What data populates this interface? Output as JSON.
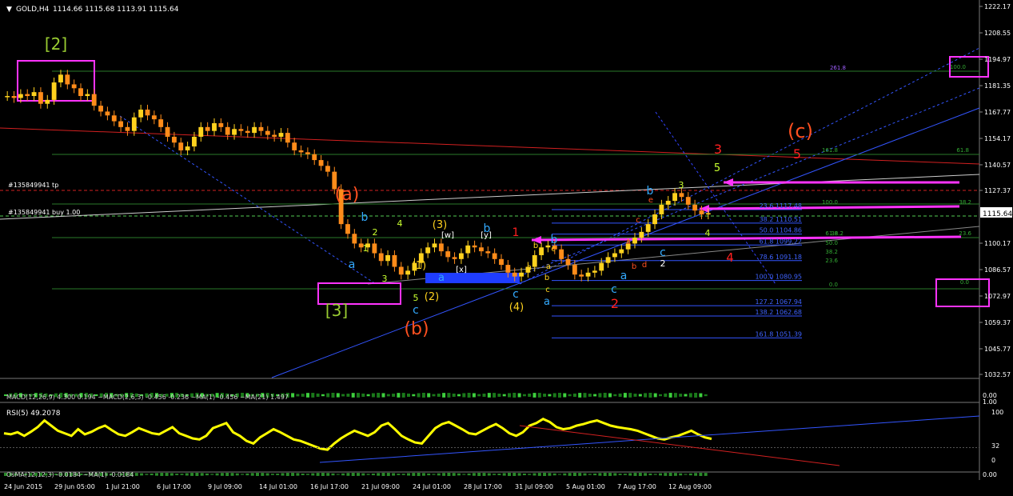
{
  "window": {
    "symbol_title": "GOLD,H4",
    "ohlc": "1114.66 1115.68 1113.91 1115.64",
    "order_tp_label": "#135849941 tp",
    "order_buy_label": "#135849941 buy 1.00",
    "current_price": "1115.64"
  },
  "chart_data": {
    "type": "line",
    "symbol": "GOLD",
    "timeframe": "H4",
    "ylim": [
      1032.57,
      1222.17
    ],
    "y_ticks": [
      "1222.17",
      "1208.55",
      "1194.97",
      "1181.35",
      "1167.77",
      "1154.17",
      "1140.57",
      "1127.37",
      "1115.64",
      "1100.17",
      "1086.57",
      "1072.97",
      "1059.37",
      "1045.77",
      "1032.57"
    ],
    "x_ticks": [
      "24 Jun 2015",
      "29 Jun 05:00",
      "1 Jul 21:00",
      "6 Jul 17:00",
      "9 Jul 09:00",
      "14 Jul 01:00",
      "16 Jul 17:00",
      "21 Jul 09:00",
      "24 Jul 01:00",
      "28 Jul 17:00",
      "31 Jul 09:00",
      "5 Aug 01:00",
      "7 Aug 17:00",
      "12 Aug 09:00"
    ],
    "series": [
      {
        "values": [
          1176,
          1175,
          1177,
          1176,
          1178,
          1172,
          1174,
          1183,
          1187,
          1182,
          1180,
          1176,
          1177,
          1171,
          1168,
          1166,
          1163,
          1160,
          1158,
          1165,
          1169,
          1166,
          1164,
          1160,
          1155,
          1152,
          1148,
          1150,
          1155,
          1160,
          1158,
          1162,
          1160,
          1156,
          1159,
          1158,
          1157,
          1160,
          1158,
          1156,
          1155,
          1157,
          1152,
          1148,
          1147,
          1146,
          1143,
          1140,
          1137,
          1128,
          1110,
          1105,
          1100,
          1098,
          1100,
          1095,
          1091,
          1094,
          1088,
          1084,
          1086,
          1090,
          1095,
          1098,
          1100,
          1096,
          1093,
          1092,
          1095,
          1099,
          1098,
          1096,
          1095,
          1092,
          1089,
          1085,
          1083,
          1085,
          1088,
          1094,
          1098,
          1099,
          1097,
          1092,
          1089,
          1084,
          1083,
          1085,
          1086,
          1090,
          1093,
          1095,
          1097,
          1100,
          1103,
          1106,
          1110,
          1115,
          1120,
          1122,
          1126,
          1124,
          1120,
          1117,
          1115,
          1115.64
        ]
      }
    ],
    "fib_levels": [
      {
        "ratio": "23.6",
        "price": "1117.48"
      },
      {
        "ratio": "38.2",
        "price": "1110.51"
      },
      {
        "ratio": "50.0",
        "price": "1104.86"
      },
      {
        "ratio": "61.8",
        "price": "1099.22"
      },
      {
        "ratio": "78.6",
        "price": "1091.18"
      },
      {
        "ratio": "100.0",
        "price": "1080.95"
      },
      {
        "ratio": "127.2",
        "price": "1067.94"
      },
      {
        "ratio": "138.2",
        "price": "1062.68"
      },
      {
        "ratio": "161.8",
        "price": "1051.39"
      }
    ],
    "fib_right": [
      "261.8",
      "161.8",
      "61.8",
      "38.2",
      "100.0",
      "38.2",
      "23.6",
      "61.8",
      "50.0",
      "38.2",
      "23.6",
      "0.0",
      "100.0",
      "0.0"
    ],
    "wave_labels": {
      "top": "[2]",
      "bottom": "[3]",
      "a_big": "(a)",
      "b_big": "(b)",
      "c_big": "(c)",
      "red3": "3",
      "red5": "5",
      "red1": "1",
      "red2": "2",
      "red4": "4",
      "w1": "1",
      "w2": "2",
      "w3": "3",
      "w4": "4",
      "w5": "5",
      "p1": "(1)",
      "p2": "(2)",
      "p3": "(3)",
      "p4": "(4)",
      "bw": "[w]",
      "bx": "[x]",
      "by": "[y]",
      "a": "a",
      "b": "b",
      "c": "c",
      "d": "d",
      "e": "e"
    },
    "indicators": {
      "macd_label": "MACD(12,26,9) 4.300 0.194 ~MACD(2,6,3) -0.456 -0.236 ~MA(1) -0.456 ~MA(21) 1.497",
      "macd_right": "0.00",
      "macd_right2": "1.00",
      "rsi_label": "RSI(5) 49.2078",
      "rsi_ticks": [
        "100",
        "32",
        "0"
      ],
      "rsi_values": [
        60,
        58,
        62,
        55,
        63,
        72,
        85,
        75,
        65,
        60,
        55,
        68,
        58,
        63,
        70,
        75,
        66,
        58,
        55,
        62,
        70,
        65,
        60,
        58,
        65,
        72,
        60,
        55,
        50,
        48,
        55,
        70,
        75,
        80,
        62,
        55,
        45,
        40,
        52,
        60,
        68,
        62,
        55,
        48,
        45,
        40,
        35,
        30,
        28,
        40,
        50,
        58,
        65,
        60,
        55,
        62,
        75,
        80,
        68,
        55,
        48,
        42,
        40,
        55,
        70,
        78,
        82,
        75,
        68,
        60,
        58,
        65,
        72,
        78,
        70,
        60,
        55,
        62,
        75,
        80,
        88,
        82,
        72,
        68,
        70,
        75,
        78,
        82,
        85,
        80,
        75,
        72,
        70,
        68,
        65,
        60,
        55,
        50,
        48,
        52,
        55,
        60,
        65,
        58,
        52,
        49
      ],
      "osma_label": "OsMA(12,12,3) -0.0184 ~MA(1) -0.0184",
      "osma_right": "0.00"
    },
    "colors": {
      "candle": "#ff8c1a",
      "up_candle": "#ffd21e",
      "red_line": "#d22020",
      "fib": "#3355ff",
      "magenta": "#ff33ff",
      "blue_zone": "#1f3dff",
      "rsi": "#ffff00"
    }
  }
}
